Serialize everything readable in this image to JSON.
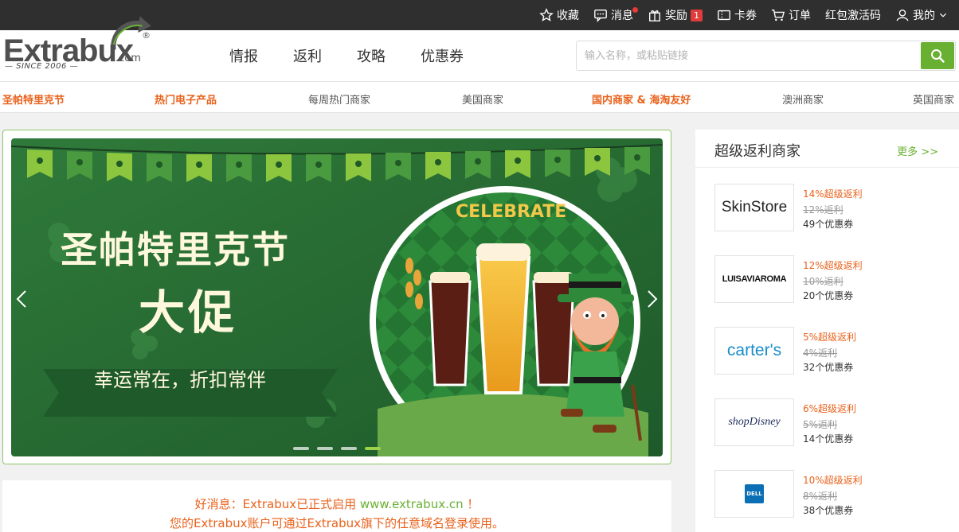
{
  "topbar": {
    "items": [
      {
        "icon": "star-icon",
        "label": "收藏"
      },
      {
        "icon": "message-icon",
        "label": "消息"
      },
      {
        "icon": "gift-icon",
        "label": "奖励",
        "badge": "1"
      },
      {
        "icon": "card-icon",
        "label": "卡券"
      },
      {
        "icon": "cart-icon",
        "label": "订单"
      },
      {
        "label": "红包激活码"
      },
      {
        "icon": "user-icon",
        "label": "我的"
      }
    ]
  },
  "logo": {
    "word": "Extrabux",
    "com": ".com",
    "since": "— SINCE 2006 —",
    "reg": "®"
  },
  "nav": [
    "情报",
    "返利",
    "攻略",
    "优惠券"
  ],
  "search": {
    "placeholder": "输入名称，或粘贴链接"
  },
  "categories": [
    {
      "label": "圣帕特里克节",
      "hot": true
    },
    {
      "label": "热门电子产品",
      "hot": true
    },
    {
      "label": "每周热门商家",
      "hot": false
    },
    {
      "label": "美国商家",
      "hot": false
    },
    {
      "label": "国内商家 & 海淘友好",
      "hot": true
    },
    {
      "label": "澳洲商家",
      "hot": false
    },
    {
      "label": "英国商家",
      "hot": false
    }
  ],
  "banner": {
    "title1": "圣帕特里克节",
    "title2": "大促",
    "ribbon": "幸运常在，折扣常伴",
    "celebrate": "CELEBRATE",
    "slides": 4,
    "active_slide": 4
  },
  "sidebar": {
    "title": "超级返利商家",
    "more": "更多 >>",
    "merchants": [
      {
        "name": "SkinStore",
        "rate": "14%超级返利",
        "old": "12%返利",
        "coupons": "49个优惠券"
      },
      {
        "name": "LUISAVIAROMA",
        "rate": "12%超级返利",
        "old": "10%返利",
        "coupons": "20个优惠券"
      },
      {
        "name": "carter's",
        "rate": "5%超级返利",
        "old": "4%返利",
        "coupons": "32个优惠券"
      },
      {
        "name": "shopDisney",
        "rate": "6%超级返利",
        "old": "5%返利",
        "coupons": "14个优惠券"
      },
      {
        "name": "DELL",
        "rate": "10%超级返利",
        "old": "8%返利",
        "coupons": "38个优惠券"
      }
    ]
  },
  "news": {
    "line1_prefix": "好消息：Extrabux已正式启用 ",
    "line1_url": "www.extrabux.cn",
    "line1_suffix": " ！",
    "line2": "您的Extrabux账户可通过Extrabux旗下的任意域名登录使用。"
  },
  "colors": {
    "brand_green": "#69b032",
    "accent_orange": "#e9621c",
    "topbar": "#2f2f2f"
  }
}
